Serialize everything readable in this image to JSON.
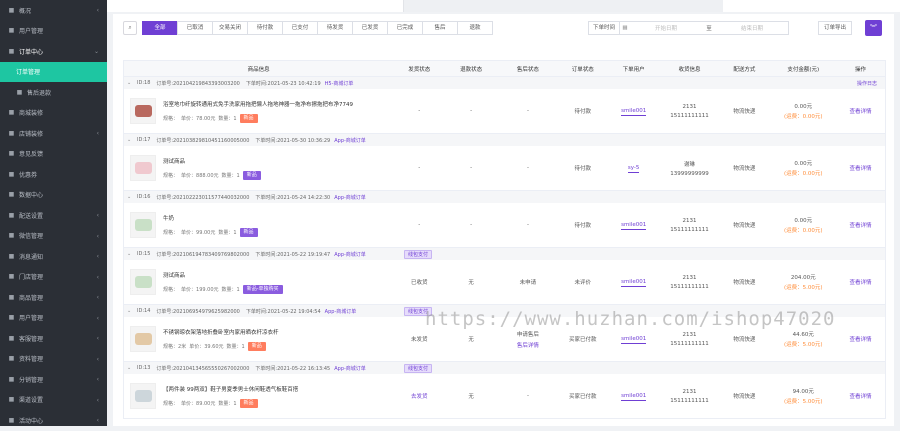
{
  "sidebar": {
    "items": [
      {
        "label": "概况",
        "icon": "home-icon",
        "chev": "‹"
      },
      {
        "label": "用户管理",
        "icon": "user-icon",
        "chev": ""
      },
      {
        "label": "订单中心",
        "icon": "doc-icon",
        "chev": "⌄",
        "section": true
      },
      {
        "label": "订单管理",
        "icon": "",
        "chev": "",
        "active": true
      },
      {
        "label": "售后退款",
        "icon": "refund-icon",
        "chev": "",
        "sub": true
      },
      {
        "label": "商城装修",
        "icon": "shop-icon",
        "chev": ""
      },
      {
        "label": "店铺装修",
        "icon": "brush-icon",
        "chev": "‹"
      },
      {
        "label": "意见反馈",
        "icon": "feedback-icon",
        "chev": ""
      },
      {
        "label": "优惠券",
        "icon": "coupon-icon",
        "chev": ""
      },
      {
        "label": "数据中心",
        "icon": "chart-icon",
        "chev": ""
      },
      {
        "label": "配送设置",
        "icon": "truck-icon",
        "chev": "‹"
      },
      {
        "label": "微信管理",
        "icon": "wechat-icon",
        "chev": "‹"
      },
      {
        "label": "消息通知",
        "icon": "bell-icon",
        "chev": "‹"
      },
      {
        "label": "门店管理",
        "icon": "store-icon",
        "chev": "‹"
      },
      {
        "label": "商品管理",
        "icon": "goods-icon",
        "chev": "‹"
      },
      {
        "label": "用户管理",
        "icon": "user-icon",
        "chev": "‹"
      },
      {
        "label": "客服管理",
        "icon": "service-icon",
        "chev": "‹"
      },
      {
        "label": "资料管理",
        "icon": "file-icon",
        "chev": "‹"
      },
      {
        "label": "分销管理",
        "icon": "share-icon",
        "chev": "‹"
      },
      {
        "label": "渠道设置",
        "icon": "gear-icon",
        "chev": "‹"
      },
      {
        "label": "活动中心",
        "icon": "gift-icon",
        "chev": "‹"
      }
    ]
  },
  "filters": {
    "tabs": [
      "全部",
      "已取消",
      "交易关闭",
      "待付款",
      "已支付",
      "待发货",
      "已发货",
      "已完成",
      "售后",
      "退款"
    ],
    "date_label": "下单时间",
    "start_placeholder": "开始日期",
    "range_sep": "至",
    "end_placeholder": "结束日期",
    "export": "订单导出"
  },
  "table": {
    "columns": [
      "商品信息",
      "发货状态",
      "退款状态",
      "售后状态",
      "订单状态",
      "下单用户",
      "收货信息",
      "配送方式",
      "支付金额(元)",
      "操作"
    ],
    "orders": [
      {
        "id": "ID:18",
        "no": "订单号:202104219843393003200",
        "time": "下单时间:2021-05-23 10:42:19",
        "source": "H5-商城订单",
        "log": "操作日志",
        "tag": "",
        "product": "浴室地巾纤旋转通用式免手洗家用拖把懒人拖地神器一拖净布擦拖把布净7749",
        "spec": "规格：",
        "price": "单价：78.00元",
        "qty": "数量：1",
        "badge": "新品",
        "badge_color": "orange",
        "ship": "-",
        "refund": "-",
        "after": "-",
        "after2": "",
        "status": "待付款",
        "user": "smile001",
        "r1": "2131",
        "r2": "15111111111",
        "delivery": "物流快递",
        "amount": "0.00元",
        "fee": "(运费：0.00元)",
        "op": "查看详情",
        "thumb": "t1"
      },
      {
        "id": "ID:17",
        "no": "订单号:202103829810451160005000",
        "time": "下单时间:2021-05-30 10:36:29",
        "source": "App-商城订单",
        "log": "",
        "tag": "",
        "product": "测试商品",
        "spec": "规格：",
        "price": "单价：888.00元",
        "qty": "数量：1",
        "badge": "新品",
        "badge_color": "purple",
        "ship": "-",
        "refund": "-",
        "after": "-",
        "after2": "",
        "status": "待付款",
        "user": "sy-5",
        "r1": "谢琳",
        "r2": "13999999999",
        "delivery": "物流快递",
        "amount": "0.00元",
        "fee": "(运费：0.00元)",
        "op": "查看详情",
        "thumb": "t2"
      },
      {
        "id": "ID:16",
        "no": "订单号:202102223011577440032000",
        "time": "下单时间:2021-05-24 14:22:30",
        "source": "App-商城订单",
        "log": "",
        "tag": "",
        "product": "牛奶",
        "spec": "规格：",
        "price": "单价：99.00元",
        "qty": "数量：1",
        "badge": "新品",
        "badge_color": "purple",
        "ship": "-",
        "refund": "-",
        "after": "-",
        "after2": "",
        "status": "待付款",
        "user": "smile001",
        "r1": "2131",
        "r2": "15111111111",
        "delivery": "物流快递",
        "amount": "0.00元",
        "fee": "(运费：0.00元)",
        "op": "查看详情",
        "thumb": "t3"
      },
      {
        "id": "ID:15",
        "no": "订单号:202106194783409769802000",
        "time": "下单时间:2021-05-22 19:19:47",
        "source": "App-商城订单",
        "log": "",
        "tag": "线包支付",
        "product": "测试商品",
        "spec": "规格：",
        "price": "单价：199.00元",
        "qty": "数量：1",
        "badge": "新品-单独购买",
        "badge_color": "purple",
        "ship": "已收货",
        "refund": "无",
        "after": "未申请",
        "after2": "",
        "status": "未评价",
        "user": "smile001",
        "r1": "2131",
        "r2": "15111111111",
        "delivery": "物流快递",
        "amount": "204.00元",
        "fee": "(运费：5.00元)",
        "op": "查看详情",
        "thumb": "t3"
      },
      {
        "id": "ID:14",
        "no": "订单号:202106954979625982000",
        "time": "下单时间:2021-05-22 19:04:54",
        "source": "App-商城订单",
        "log": "",
        "tag": "线包支付",
        "product": "不锈钢晾衣架落地折叠卧室内家用晒衣杆凉衣杆",
        "spec": "规格：2米",
        "price": "单价：39.60元",
        "qty": "数量：1",
        "badge": "新品",
        "badge_color": "orange",
        "ship": "未发货",
        "refund": "无",
        "after": "申请售后",
        "after2": "售后详情",
        "status": "买家已付款",
        "user": "smile001",
        "r1": "2131",
        "r2": "15111111111",
        "delivery": "物流快递",
        "amount": "44.60元",
        "fee": "(运费：5.00元)",
        "op": "查看详情",
        "thumb": "t6"
      },
      {
        "id": "ID:13",
        "no": "订单号:202104134565550267002000",
        "time": "下单时间:2021-05-22 16:13:45",
        "source": "App-商城订单",
        "log": "",
        "tag": "线包支付",
        "product": "【两件装 99两双】鞋子男夏季男士休闲鞋透气板鞋百搭",
        "spec": "规格：",
        "price": "单价：89.00元",
        "qty": "数量：1",
        "badge": "新品",
        "badge_color": "orange",
        "ship": "去发货",
        "refund": "无",
        "after": "-",
        "after2": "",
        "status": "买家已付款",
        "user": "smile001",
        "r1": "2131",
        "r2": "15111111111",
        "delivery": "物流快递",
        "amount": "94.00元",
        "fee": "(运费：5.00元)",
        "op": "查看详情",
        "thumb": "t7"
      }
    ]
  },
  "watermark": "https://www.huzhan.com/ishop47020"
}
